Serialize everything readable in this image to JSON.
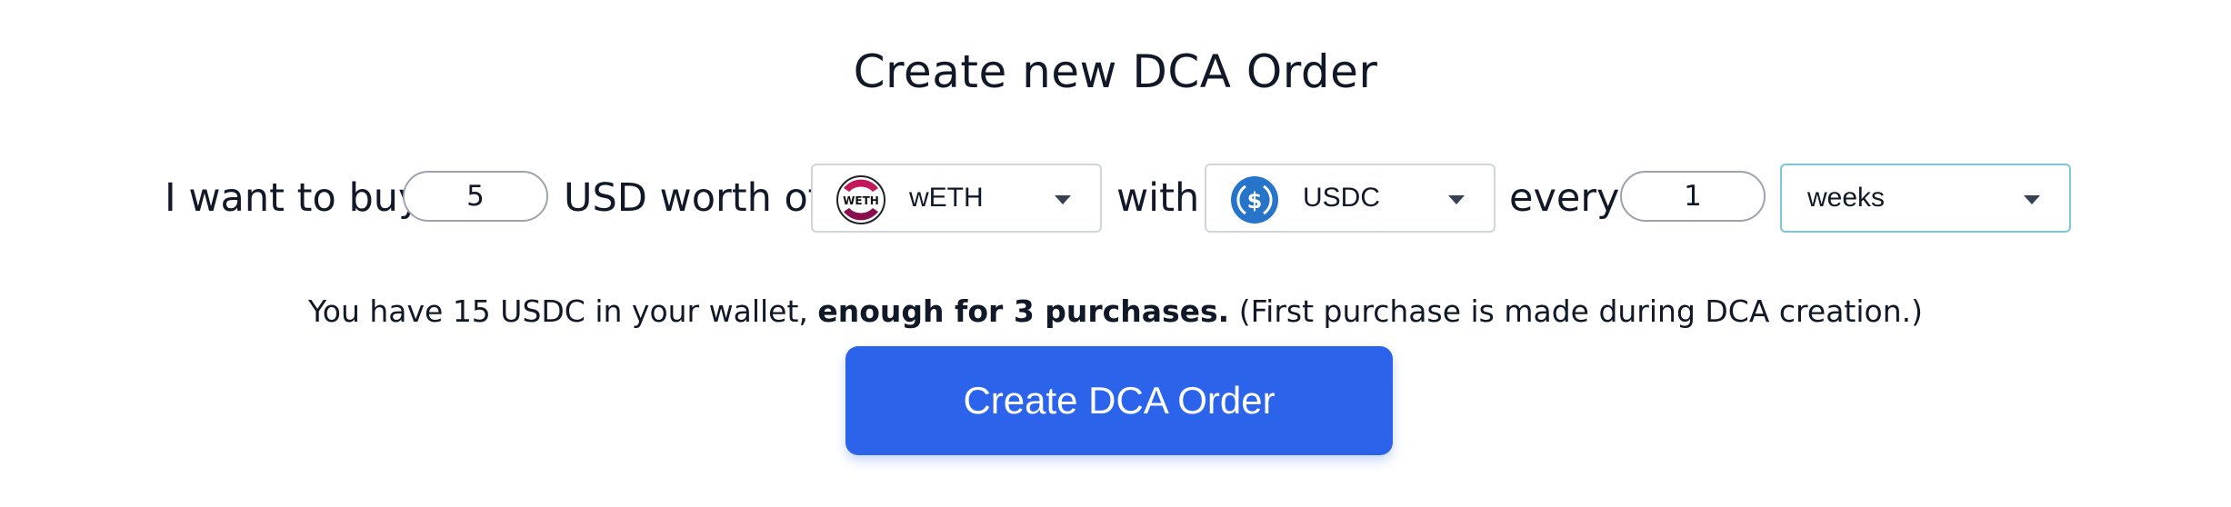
{
  "page": {
    "title": "Create new DCA Order"
  },
  "order_form": {
    "text_buy": "I want to buy",
    "amount_value": "5",
    "text_usd_worth_of": "USD worth of",
    "buy_token": {
      "label": "wETH",
      "icon": "weth-token-icon",
      "icon_text": "WETH"
    },
    "text_with": "with",
    "pay_token": {
      "label": "USDC",
      "icon": "usdc-token-icon",
      "color": "#2775ca"
    },
    "text_every": "every",
    "interval_value": "1",
    "interval_unit": {
      "label": "weeks"
    }
  },
  "info": {
    "prefix": "You have 15 USDC in your wallet,",
    "emphasis": "enough for 3 purchases.",
    "suffix": "(First purchase is made during DCA creation.)"
  },
  "actions": {
    "create_label": "Create DCA Order",
    "accent": "#2b63eb"
  }
}
